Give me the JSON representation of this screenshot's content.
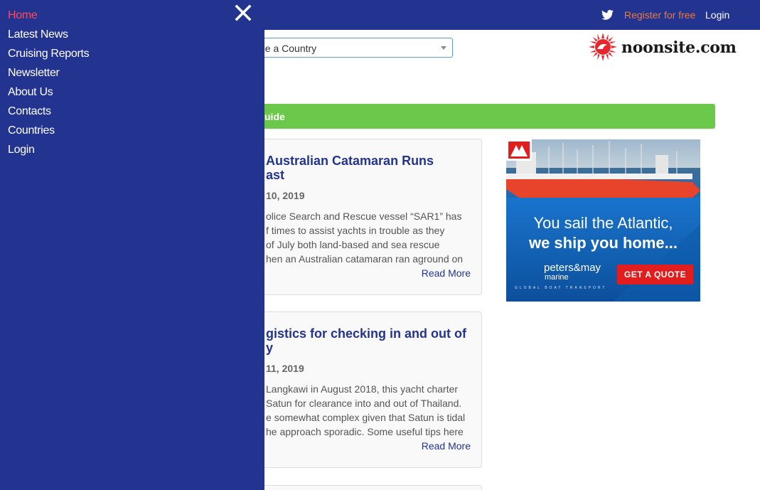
{
  "header": {
    "twitter_icon": "twitter-icon",
    "register_label": "Register for free",
    "login_label": "Login",
    "bg_color": "#233490",
    "register_color": "#f07836"
  },
  "country_select": {
    "visible_text": "be a Country"
  },
  "logo": {
    "text": "noonsite.com"
  },
  "guide_bar": {
    "visible_text": "uide",
    "color": "#6cc84a"
  },
  "cards": [
    {
      "title_line1": "Australian Catamaran Runs",
      "title_line2": "ast",
      "date": "10, 2019",
      "body": [
        "olice Search and Rescue vessel “SAR1” has",
        "f times to assist yachts in trouble as they",
        "of July both land-based and sea rescue",
        "hen an Australian catamaran ran aground on"
      ],
      "read_more": "Read More"
    },
    {
      "title_line1": "gistics for checking in and out of",
      "title_line2": "y",
      "date": "11, 2019",
      "body": [
        "Langkawi in August 2018, this yacht charter",
        "Satun for clearance into and out of Thailand.",
        "e somewhat complex given that Satun is tidal",
        "he approach sporadic. Some useful tips here"
      ],
      "read_more": "Read More"
    }
  ],
  "ad": {
    "line1": "You sail the Atlantic,",
    "line2": "we ship you home...",
    "brand": "peters&may",
    "brand_sub": "marine",
    "tagline": "GLOBAL BOAT TRANSPORT",
    "cta": "GET A QUOTE"
  },
  "side_menu": {
    "close_icon": "close-icon",
    "items": [
      {
        "label": "Home",
        "active": true
      },
      {
        "label": "Latest News"
      },
      {
        "label": "Cruising Reports"
      },
      {
        "label": "Newsletter"
      },
      {
        "label": "About Us"
      },
      {
        "label": "Contacts"
      },
      {
        "label": "Countries"
      },
      {
        "label": "Login"
      }
    ],
    "active_color": "#ff4a5b"
  }
}
